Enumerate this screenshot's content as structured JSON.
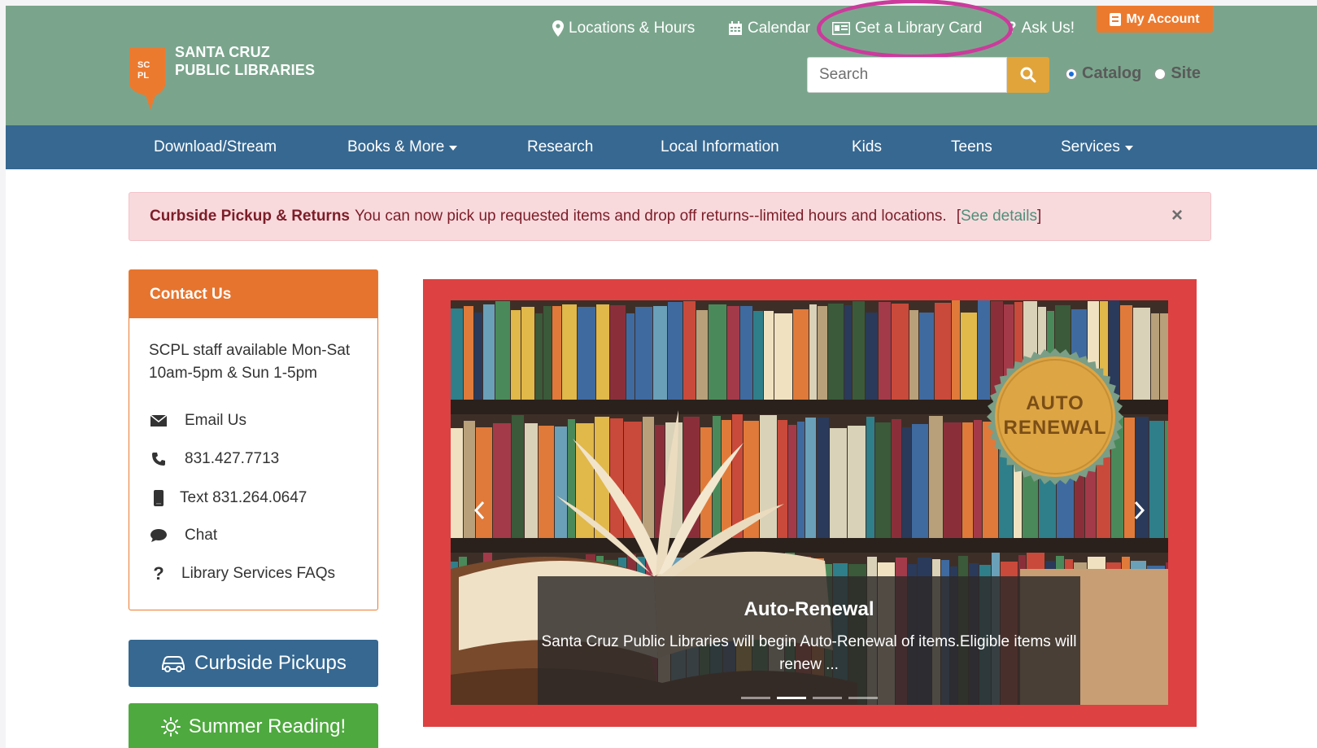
{
  "header": {
    "logo_mark": "SC PL",
    "logo_line1": "SANTA CRUZ",
    "logo_line2": "PUBLIC LIBRARIES",
    "utility_links": {
      "locations": "Locations & Hours",
      "calendar": "Calendar",
      "library_card": "Get a Library Card",
      "ask": "Ask Us!"
    },
    "my_account": "My Account",
    "search": {
      "placeholder": "Search",
      "value": ""
    },
    "search_scope": {
      "options": [
        "Catalog",
        "Site"
      ],
      "selected": "Catalog"
    },
    "highlight_color": "#cc3a9c"
  },
  "nav": {
    "items": [
      {
        "label": "Download/Stream",
        "dropdown": false
      },
      {
        "label": "Books & More",
        "dropdown": true
      },
      {
        "label": "Research",
        "dropdown": false
      },
      {
        "label": "Local Information",
        "dropdown": false
      },
      {
        "label": "Kids",
        "dropdown": false
      },
      {
        "label": "Teens",
        "dropdown": false
      },
      {
        "label": "Services",
        "dropdown": true
      }
    ]
  },
  "alert": {
    "title": "Curbside Pickup & Returns",
    "message": "You can now pick up requested items and drop off returns--limited hours and locations.",
    "link_open": "[",
    "link_text": "See details",
    "link_close": "]",
    "close": "×"
  },
  "contact": {
    "title": "Contact Us",
    "hours": "SCPL staff available Mon-Sat 10am-5pm & Sun 1-5pm",
    "items": [
      {
        "icon": "envelope-icon",
        "label": "Email Us"
      },
      {
        "icon": "phone-icon",
        "label": "831.427.7713"
      },
      {
        "icon": "mobile-icon",
        "label": "Text 831.264.0647"
      },
      {
        "icon": "chat-bubble-icon",
        "label": "Chat"
      },
      {
        "icon": "question-icon",
        "label": "Library Services FAQs"
      }
    ]
  },
  "buttons": {
    "curbside": "Curbside Pickups",
    "summer": "Summer Reading!"
  },
  "carousel": {
    "badge_line1": "AUTO",
    "badge_line2": "RENEWAL",
    "caption_title": "Auto-Renewal",
    "caption_text": "Santa Cruz Public Libraries will begin Auto-Renewal of items.Eligible items will renew ...",
    "slide_count": 4,
    "active_slide": 2
  },
  "colors": {
    "header_bg": "#7aa58c",
    "nav_bg": "#366891",
    "accent_orange": "#ec7a2e",
    "search_button": "#e0a43a",
    "carousel_frame": "#dd4141",
    "summer_green": "#4ea93f"
  }
}
